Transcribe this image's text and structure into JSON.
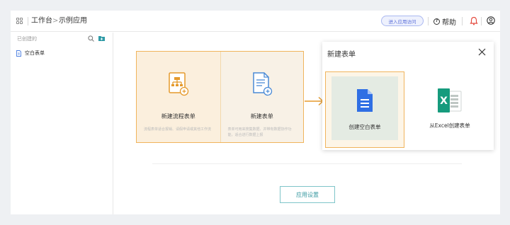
{
  "header": {
    "breadcrumb": [
      "工作台",
      "示例应用"
    ],
    "separator": ">",
    "visit_app_label": "进入应用访问",
    "help_label": "帮助",
    "help_glyph": "?"
  },
  "sidebar": {
    "heading": "已创建的",
    "items": [
      {
        "label": "空白表单",
        "icon": "form-doc-icon"
      }
    ]
  },
  "templates": [
    {
      "title": "新建流程表单",
      "description": "流程表单适合报销、请假申请或其他工作流",
      "icon": "flow-form-icon"
    },
    {
      "title": "新建表单",
      "description": "表单可用来搜集数据、并带有数据协作功能，适合进行数据上报",
      "icon": "new-form-icon"
    }
  ],
  "popup": {
    "title": "新建表单",
    "options": [
      {
        "label": "创建空白表单",
        "icon": "blank-doc-icon"
      },
      {
        "label": "从Excel创建表单",
        "icon": "excel-icon"
      }
    ]
  },
  "footer": {
    "settings_label": "应用设置"
  },
  "colors": {
    "accent_orange": "#f0b45c",
    "blue_doc": "#2f6fe4",
    "excel_green": "#169b7d",
    "teal_button": "#3b9aa2",
    "bell_red": "#e44b3f"
  }
}
